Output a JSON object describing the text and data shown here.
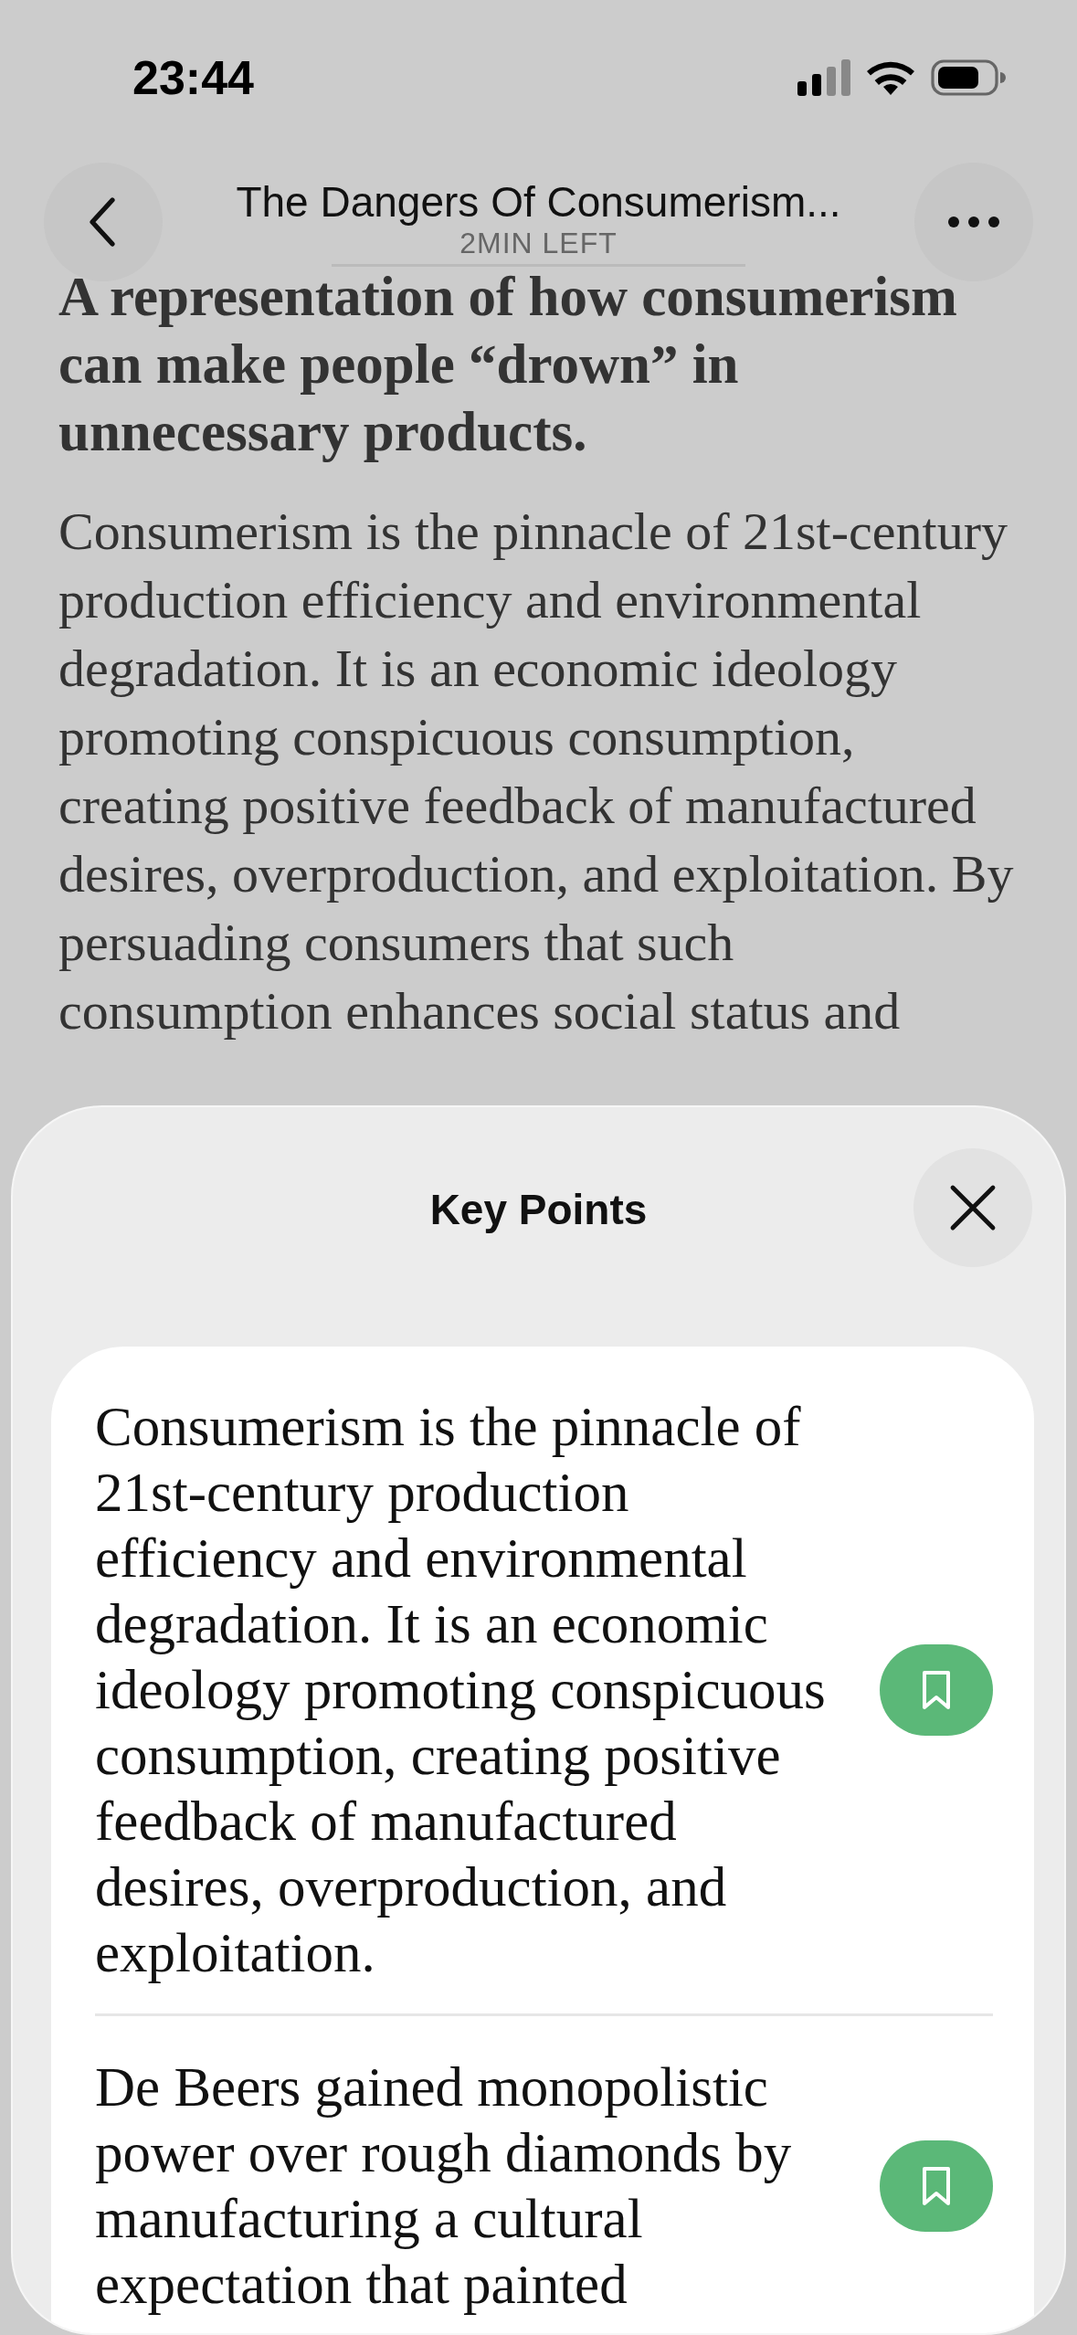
{
  "status_bar": {
    "time": "23:44"
  },
  "header": {
    "title": "The Dangers Of Consumerism...",
    "subtitle": "2MIN LEFT"
  },
  "article": {
    "caption": "A representation of how consumerism can make people “drown” in unnecessary products.",
    "body": "Consumerism is the pinnacle of 21st-century production efficiency and environmental degradation. It is an economic ideology promoting conspicuous consumption, creating positive feedback of manufactured desires, overproduction, and exploitation. By persuading consumers that such consumption enhances social status and"
  },
  "sheet": {
    "title": "Key Points",
    "points": [
      {
        "text": "Consumerism is the pinnacle of 21st-century production efficiency and environmental degradation. It is an economic ideology promoting conspicuous consumption, creating positive feedback of manufactured desires, overproduction, and exploitation.",
        "bookmarked": true
      },
      {
        "text": "De Beers gained monopolistic power over rough diamonds by manufacturing a cultural expectation that painted",
        "bookmarked": true
      }
    ]
  }
}
